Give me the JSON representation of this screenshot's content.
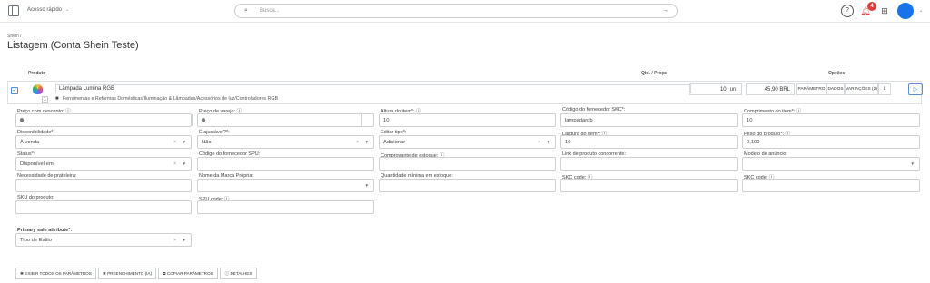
{
  "topbar": {
    "quick_access": "Acesso rápido",
    "search_placeholder": "Busca...",
    "notification_count": "4"
  },
  "breadcrumb": "Shein /",
  "page_title": "Listagem (Conta Shein Teste)",
  "table_headers": {
    "product": "Produto",
    "qty_price": "Qtd. / Preço",
    "options": "Opções"
  },
  "product": {
    "name": "Lâmpada Lumina RGB",
    "qty_badge": "1",
    "category": "Ferramentas e Reformas Domésticas/Iluminação & Lâmpadas/Acessórios de luz/Controladores RGB",
    "quantity": "10",
    "unit": "un.",
    "price": "45,90",
    "currency": "BRL",
    "option_buttons": [
      "PARÂMETRO",
      "DADOS",
      "VARIAÇÕES (2)",
      "⇕"
    ]
  },
  "fields": {
    "preco_desconto": {
      "label": "Preço com desconto: ⓘ",
      "value": ""
    },
    "preco_varejo": {
      "label": "Preço de varejo: ⓘ",
      "value": ""
    },
    "altura": {
      "label": "Altura do item*: ⓘ",
      "value": "10"
    },
    "codigo_skc": {
      "label": "Código do fornecedor SKC*:",
      "value": "lampadargb"
    },
    "comprimento": {
      "label": "Comprimento do item*: ⓘ",
      "value": "10"
    },
    "disponibilidade": {
      "label": "Disponibilidade*:",
      "value": "À venda"
    },
    "ajustavel": {
      "label": "É ajustável?*:",
      "value": "Não"
    },
    "editar_tipo": {
      "label": "Editar tipo*:",
      "value": "Adicionar"
    },
    "largura": {
      "label": "Largura do item*: ⓘ",
      "value": "10"
    },
    "peso": {
      "label": "Peso do produto*: ⓘ",
      "value": "0,100"
    },
    "status": {
      "label": "Status*:",
      "value": "Disponível em"
    },
    "codigo_spu": {
      "label": "Código do fornecedor SPU:",
      "value": ""
    },
    "comprovante": {
      "label": "Comprovante de estoque: ⓘ",
      "value": ""
    },
    "link_concorrente": {
      "label": "Link de produto concorrente:",
      "value": ""
    },
    "modelo_anuncio": {
      "label": "Modelo de anúncio:",
      "value": ""
    },
    "prateleira": {
      "label": "Necessidade de prateleira:",
      "value": ""
    },
    "marca_propria": {
      "label": "Nome da Marca Própria:",
      "value": ""
    },
    "qtd_minima": {
      "label": "Quantidade mínima em estoque:",
      "value": ""
    },
    "skc_code_1": {
      "label": "SKC code: ⓘ",
      "value": ""
    },
    "skc_code_2": {
      "label": "SKC code: ⓘ",
      "value": ""
    },
    "sku_produto": {
      "label": "SKU do produto:",
      "value": ""
    },
    "spu_code": {
      "label": "SPU code: ⓘ",
      "value": ""
    },
    "primary_sale": {
      "label": "Primary sale attribute*:",
      "value": "Tipo de Estilo"
    }
  },
  "bottom_buttons": {
    "show_all": "✱ EXIBIR TODOS OS PARÂMETROS",
    "autofill": "✱ PREENCHIMENTO (IA)",
    "copy": "⧉ COPIAR PARÂMETROS",
    "details": "ⓘ DETALHES"
  }
}
